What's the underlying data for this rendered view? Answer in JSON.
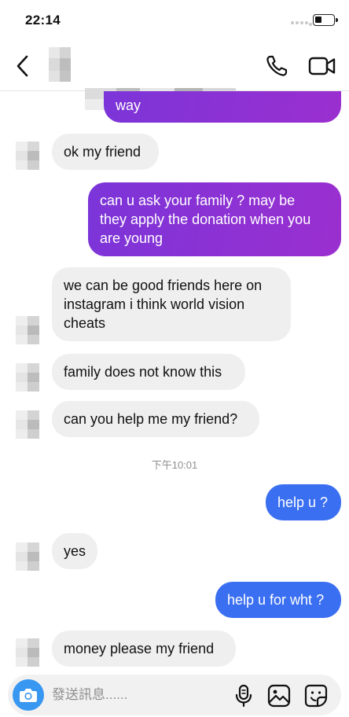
{
  "status_bar": {
    "time": "22:14"
  },
  "header": {
    "contact_name": ""
  },
  "messages": [
    {
      "dir": "out",
      "style": "purple",
      "text": "way"
    },
    {
      "dir": "in",
      "text": "ok my friend"
    },
    {
      "dir": "out",
      "style": "purple",
      "text": "can u ask your family ? may be\nthey apply the donation when you\nare young"
    },
    {
      "dir": "in",
      "text": "we can be good friends here on\ninstagram i think world vision\ncheats"
    },
    {
      "dir": "in",
      "text": "family does not know this"
    },
    {
      "dir": "in",
      "text": "can you help me my friend?"
    },
    {
      "dir": "out",
      "style": "blue",
      "text": "help u ?"
    },
    {
      "dir": "in",
      "text": "yes"
    },
    {
      "dir": "out",
      "style": "blue",
      "text": "help u for wht ?"
    },
    {
      "dir": "in",
      "text": "money please my friend"
    }
  ],
  "timestamp": "下午10:01",
  "composer": {
    "placeholder": "發送訊息......"
  },
  "colors": {
    "outgoing_purple": "#8a32d4",
    "outgoing_blue": "#3a6ff1",
    "incoming": "#efefef",
    "camera": "#3897f0"
  }
}
